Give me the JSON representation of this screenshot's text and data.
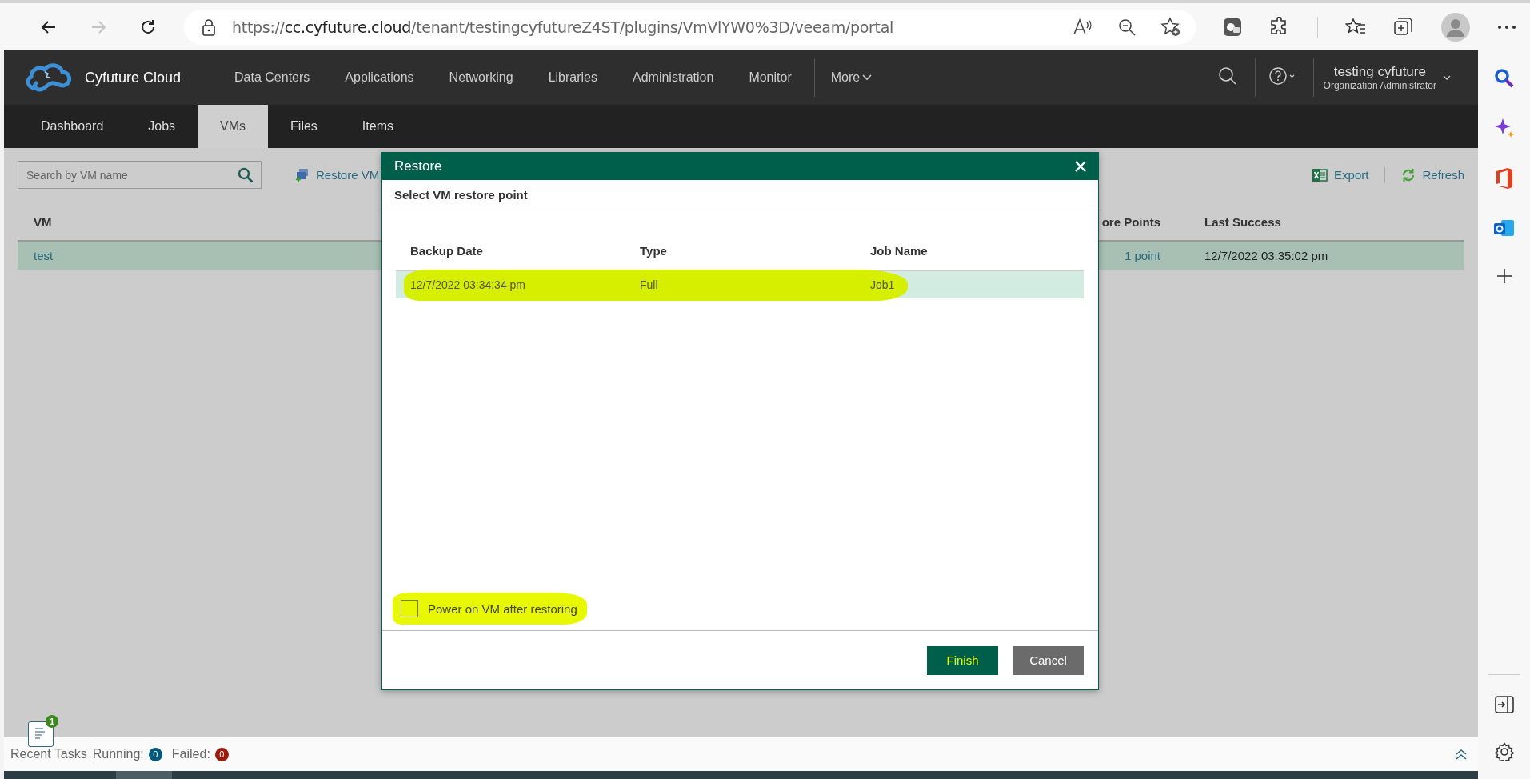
{
  "browser": {
    "nav_buttons": [
      {
        "kind": "back",
        "disabled": false
      },
      {
        "kind": "forward",
        "disabled": true
      },
      {
        "kind": "reload",
        "disabled": false
      }
    ],
    "url": {
      "scheme": "https://",
      "host": "cc.cyfuture.cloud",
      "path": "/tenant/testingcyfutureZ4ST/plugins/VmVlYW0%3D/veeam/portal"
    }
  },
  "app_header": {
    "brand": "Cyfuture Cloud",
    "nav": [
      "Data Centers",
      "Applications",
      "Networking",
      "Libraries",
      "Administration",
      "Monitor"
    ],
    "more": "More",
    "user": {
      "name": "testing cyfuture",
      "role": "Organization Administrator"
    }
  },
  "tabs": [
    {
      "label": "Dashboard",
      "selected": false
    },
    {
      "label": "Jobs",
      "selected": false
    },
    {
      "label": "VMs",
      "selected": true
    },
    {
      "label": "Files",
      "selected": false
    },
    {
      "label": "Items",
      "selected": false
    }
  ],
  "toolbar": {
    "search": {
      "placeholder": "Search by VM name"
    },
    "restore": "Restore VM",
    "export": "Export",
    "refresh": "Refresh"
  },
  "table": {
    "columns": [
      "VM",
      "ore Points",
      "Last Success"
    ],
    "rows": [
      {
        "cells": [
          "test",
          "1 point",
          "12/7/2022 03:35:02 pm"
        ],
        "selected": true
      }
    ]
  },
  "dialog": {
    "title": "Restore",
    "subtitle": "Select VM restore point",
    "columns": [
      "Backup Date",
      "Type",
      "Job Name"
    ],
    "rows": [
      {
        "cells": [
          "12/7/2022 03:34:34 pm",
          "Full",
          "Job1"
        ],
        "selected": true
      }
    ],
    "option": {
      "label": "Power on VM after restoring",
      "checked": false
    },
    "buttons": [
      {
        "label": "Finish",
        "kind": "primary"
      },
      {
        "label": "Cancel",
        "kind": "secondary"
      }
    ]
  },
  "status_bar": {
    "notifications": "1",
    "recent": "Recent Tasks",
    "running_label": "Running:",
    "running": "0",
    "failed_label": "Failed:",
    "failed": "0"
  }
}
